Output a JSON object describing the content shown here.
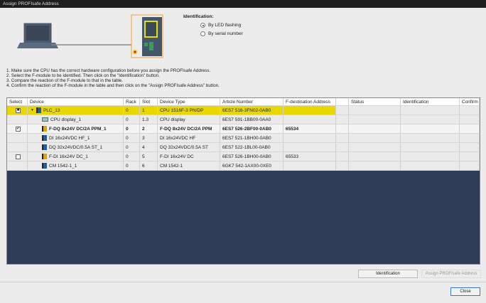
{
  "title": "Assign PROFIsafe Address",
  "identification": {
    "heading": "Identification:",
    "options": [
      {
        "label": "By LED flashing",
        "selected": true
      },
      {
        "label": "By serial number",
        "selected": false
      }
    ]
  },
  "instructions": [
    "1. Make sure the CPU has the correct hardware configuration before you assign the PROFIsafe Address.",
    "2. Select the F-module to be identified. Then click on the \"Identification\" button.",
    "3. Compare the reaction of the F-module to that in the table.",
    "4. Confirm the reaction of the F-module in the table and then click on the \"Assign PROFIsafe Address\" button."
  ],
  "table": {
    "columns": [
      "Select",
      "Device",
      "Rack",
      "Slot",
      "Device Type",
      "Article Number",
      "F-destination Address",
      "",
      "Status",
      "Identification",
      "Confirm"
    ],
    "rows": [
      {
        "select": "partial",
        "device": "PLC_13",
        "rack": "0",
        "slot": "1",
        "type": "CPU 1516F-3 PN/DP",
        "article": "6ES7 516-3FN02-0AB0",
        "fdest": "",
        "icon": "cpu-icon"
      },
      {
        "select": "none",
        "device": "CPU display_1",
        "rack": "0",
        "slot": "1.3",
        "type": "CPU display",
        "article": "6ES7 591-1BB00-0AA0",
        "fdest": "",
        "icon": "display-icon"
      },
      {
        "select": "checked",
        "device": "F-DQ 8x24V DC/2A PPM_1",
        "rack": "0",
        "slot": "2",
        "type": "F-DQ 8x24V DC/2A PPM",
        "article": "6ES7 526-2BF00-0AB0",
        "fdest": "65534",
        "icon": "f-module-icon"
      },
      {
        "select": "none",
        "device": "DI 16x24VDC HF_1",
        "rack": "0",
        "slot": "3",
        "type": "DI 16x24VDC HF",
        "article": "6ES7 521-1BH00-0AB0",
        "fdest": "",
        "icon": "module-icon"
      },
      {
        "select": "none",
        "device": "DQ 32x24VDC/0.5A ST_1",
        "rack": "0",
        "slot": "4",
        "type": "DQ 32x24VDC/0.5A ST",
        "article": "6ES7 522-1BL00-0AB0",
        "fdest": "",
        "icon": "module-icon"
      },
      {
        "select": "unchecked",
        "device": "F-DI 16x24V DC_1",
        "rack": "0",
        "slot": "5",
        "type": "F-DI 16x24V DC",
        "article": "6ES7 526-1BH00-0AB0",
        "fdest": "65533",
        "icon": "f-module-icon"
      },
      {
        "select": "none",
        "device": "CM 1542-1_1",
        "rack": "0",
        "slot": "6",
        "type": "CM 1542-1",
        "article": "6GK7 542-1AX00-0XE0",
        "fdest": "",
        "icon": "module-icon"
      }
    ]
  },
  "buttons": {
    "identification": "Identification",
    "assign": "Assign PROFIsafe Address",
    "close": "Close"
  },
  "colors": {
    "highlight": "#e8d800",
    "table_bg": "#2f3b57"
  }
}
